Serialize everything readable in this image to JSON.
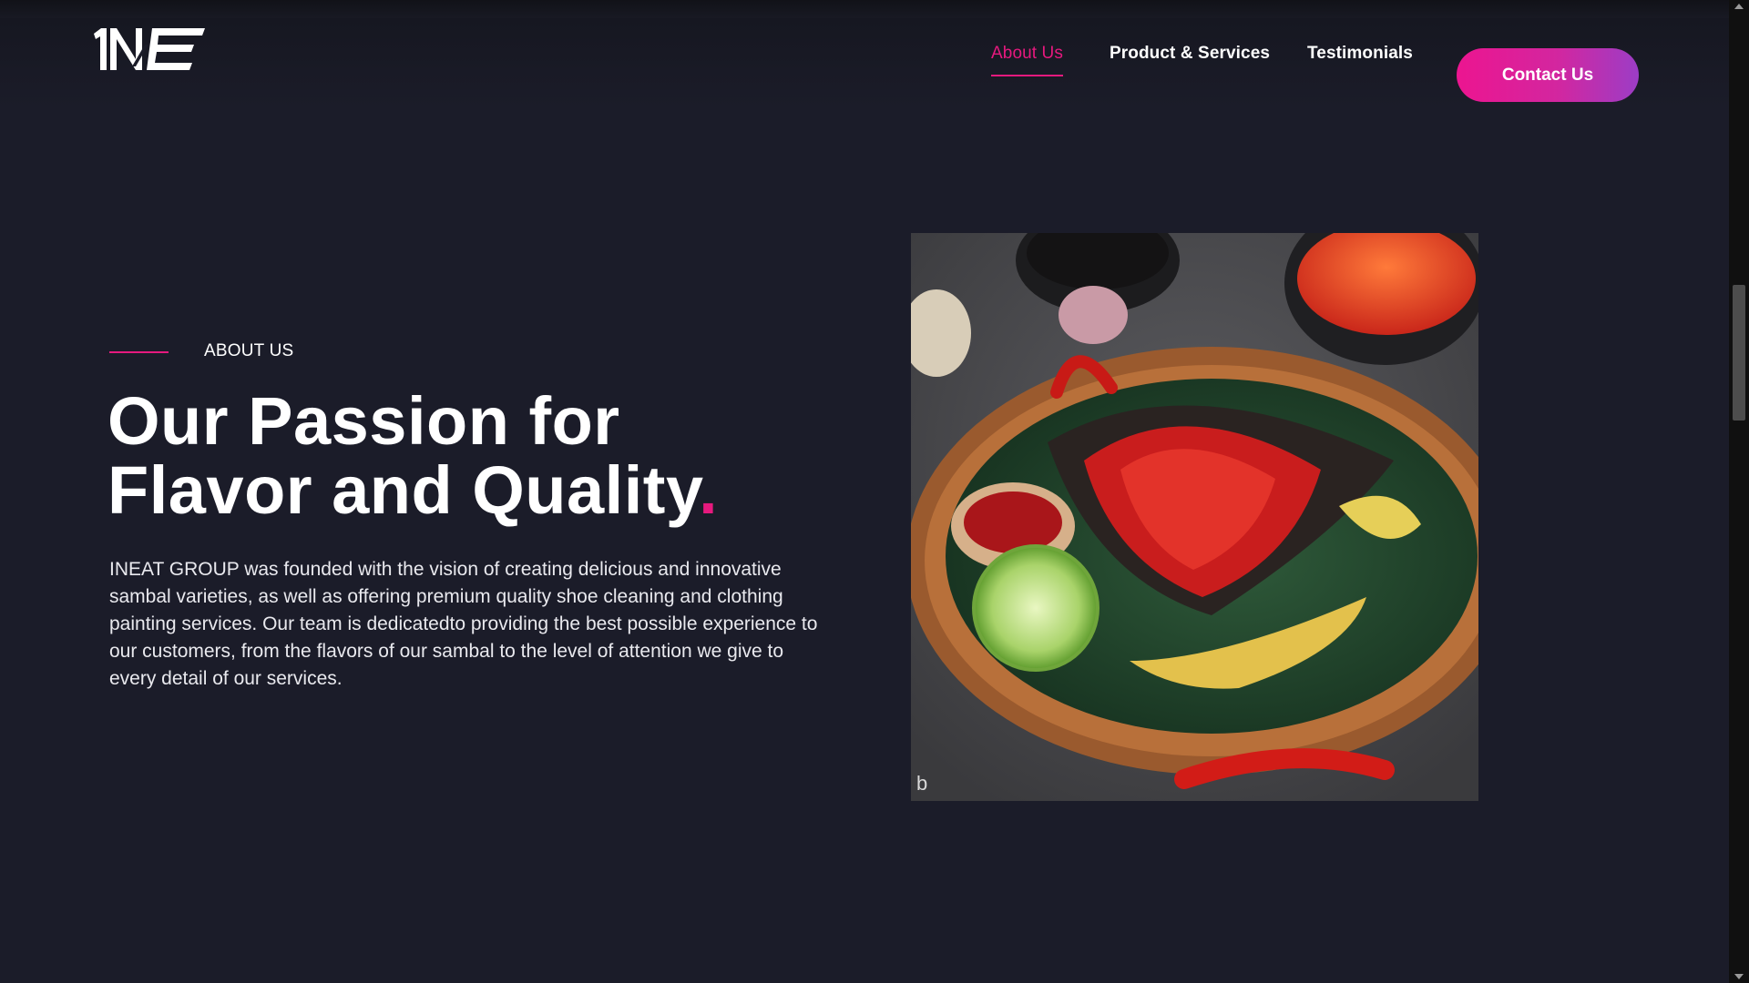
{
  "header": {
    "logo_text": "INE",
    "nav": [
      {
        "label": "About Us",
        "active": true
      },
      {
        "label": "Product & Services",
        "active": false
      },
      {
        "label": "Testimonials",
        "active": false
      }
    ],
    "cta_label": "Contact Us"
  },
  "about": {
    "eyebrow": "ABOUT US",
    "headline_line1": "Our Passion for",
    "headline_line2": "Flavor and Quality",
    "headline_dot": ".",
    "body": "INEAT GROUP was founded with the vision of creating delicious and innovative sambal varieties, as well as offering premium quality shoe cleaning and clothing painting services. Our team is dedicatedto providing the best possible experience to our customers, from the flavors of our sambal to the level of attention we give to every detail of our services."
  },
  "colors": {
    "background": "#1b1c29",
    "accent": "#e6197e",
    "cta_gradient_start": "#ec1590",
    "cta_gradient_end": "#9c3dc6"
  },
  "image": {
    "subject": "sambal-dish-photo"
  }
}
